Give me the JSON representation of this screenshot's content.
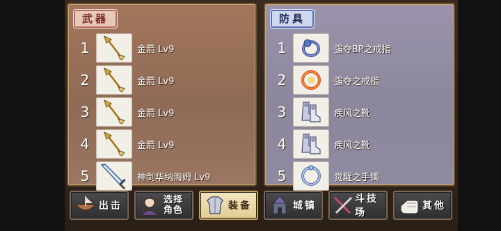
{
  "weapons": {
    "tab": "武器",
    "items": [
      {
        "num": "1",
        "name": "金箭 Lv9",
        "icon": "arrow-icon"
      },
      {
        "num": "2",
        "name": "金箭 Lv9",
        "icon": "arrow-icon"
      },
      {
        "num": "3",
        "name": "金箭 Lv9",
        "icon": "arrow-icon"
      },
      {
        "num": "4",
        "name": "金箭 Lv9",
        "icon": "arrow-icon"
      },
      {
        "num": "5",
        "name": "神剑华纳海姆 Lv9",
        "icon": "sword-icon"
      }
    ]
  },
  "armor": {
    "tab": "防具",
    "items": [
      {
        "num": "1",
        "name": "强夺BP之戒指",
        "icon": "blue-ring-icon"
      },
      {
        "num": "2",
        "name": "强夺之戒指",
        "icon": "red-ring-icon"
      },
      {
        "num": "3",
        "name": "疾风之靴",
        "icon": "boots-icon"
      },
      {
        "num": "4",
        "name": "疾风之靴",
        "icon": "boots-icon"
      },
      {
        "num": "5",
        "name": "觉醒之手镯",
        "icon": "bracelet-icon"
      }
    ]
  },
  "nav": {
    "sortie": "出击",
    "select_line1": "选择",
    "select_line2": "角色",
    "equip": "装备",
    "town": "城镇",
    "arena": "斗技场",
    "other": "其他"
  },
  "colors": {
    "weapon_panel": "#9a735c",
    "armor_panel": "#8e899e",
    "active_button": "#ead7a8"
  }
}
